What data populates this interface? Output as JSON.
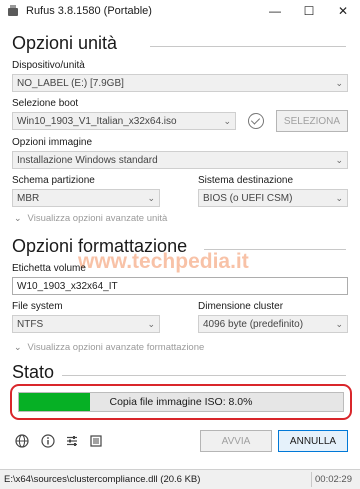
{
  "window": {
    "title": "Rufus 3.8.1580 (Portable)",
    "minimize": "—",
    "maximize": "☐",
    "close": "✕"
  },
  "drive_properties": {
    "heading": "Opzioni unità",
    "device_label": "Dispositivo/unità",
    "device_value": "NO_LABEL (E:) [7.9GB]",
    "boot_label": "Selezione boot",
    "boot_value": "Win10_1903_V1_Italian_x32x64.iso",
    "select_button": "SELEZIONA",
    "image_option_label": "Opzioni immagine",
    "image_option_value": "Installazione Windows standard",
    "partition_label": "Schema partizione",
    "partition_value": "MBR",
    "target_label": "Sistema destinazione",
    "target_value": "BIOS (o UEFI CSM)",
    "advanced_link": "Visualizza opzioni avanzate unità"
  },
  "format_options": {
    "heading": "Opzioni formattazione",
    "volume_label": "Etichetta volume",
    "volume_value": "W10_1903_x32x64_IT",
    "filesystem_label": "File system",
    "filesystem_value": "NTFS",
    "cluster_label": "Dimensione cluster",
    "cluster_value": "4096 byte (predefinito)",
    "advanced_link": "Visualizza opzioni avanzate formattazione"
  },
  "status": {
    "heading": "Stato",
    "progress_text": "Copia file immagine ISO: 8.0%",
    "progress_percent": 8.0,
    "progress_visual_fill_percent": 22
  },
  "toolbar": {
    "icons": [
      "globe-icon",
      "info-icon",
      "settings-sliders-icon",
      "log-icon"
    ],
    "start_button": "AVVIA",
    "cancel_button": "ANNULLA"
  },
  "statusbar": {
    "path": "E:\\x64\\sources\\clustercompliance.dll (20.6 KB)",
    "time": "00:02:29"
  },
  "watermark": "www.techpedia.it",
  "colors": {
    "progress_fill": "#06b025",
    "highlight_outline": "#d9262b",
    "watermark": "#f0783c"
  }
}
